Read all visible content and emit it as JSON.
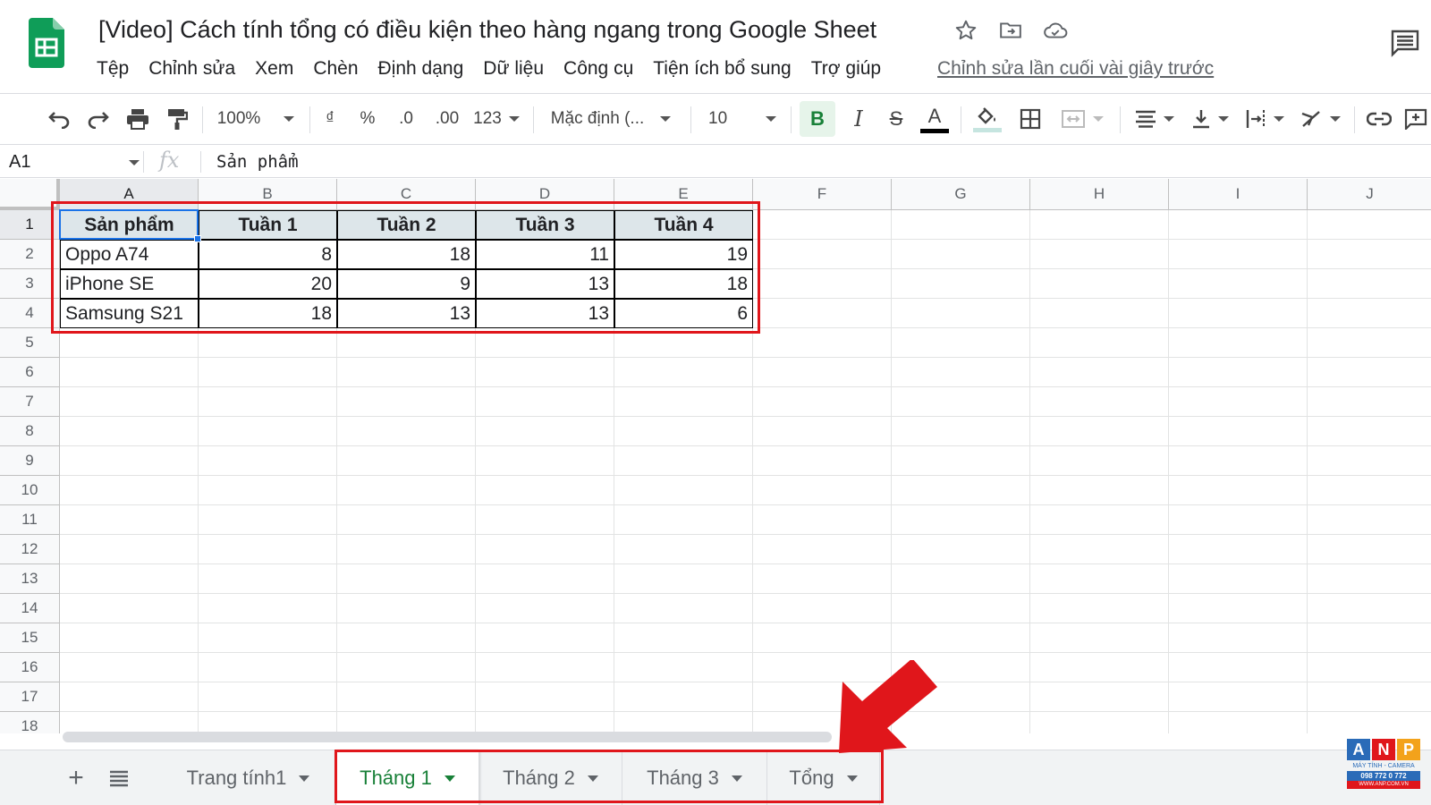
{
  "header": {
    "title": "[Video] Cách tính tổng có điều kiện theo hàng ngang trong Google Sheet",
    "menu": [
      "Tệp",
      "Chỉnh sửa",
      "Xem",
      "Chèn",
      "Định dạng",
      "Dữ liệu",
      "Công cụ",
      "Tiện ích bổ sung",
      "Trợ giúp"
    ],
    "last_edit": "Chỉnh sửa lần cuối vài giây trước"
  },
  "toolbar": {
    "zoom": "100%",
    "currency": "₫",
    "percent": "%",
    "dec_decrease": ".0",
    "dec_increase": ".00",
    "format_more": "123",
    "font": "Mặc định (...",
    "font_size": "10",
    "bold": "B",
    "italic": "I",
    "strike": "S",
    "text_color": "A"
  },
  "formula_bar": {
    "cell_ref": "A1",
    "fx": "fx",
    "content": "Sản phẩm"
  },
  "columns": [
    "A",
    "B",
    "C",
    "D",
    "E",
    "F",
    "G",
    "H",
    "I",
    "J"
  ],
  "rows": [
    "1",
    "2",
    "3",
    "4",
    "5",
    "6",
    "7",
    "8",
    "9",
    "10",
    "11",
    "12",
    "13",
    "14",
    "15",
    "16",
    "17",
    "18"
  ],
  "table": {
    "headers": [
      "Sản phẩm",
      "Tuần 1",
      "Tuần 2",
      "Tuần 3",
      "Tuần 4"
    ],
    "data": [
      [
        "Oppo A74",
        "8",
        "18",
        "11",
        "19"
      ],
      [
        "iPhone SE",
        "20",
        "9",
        "13",
        "18"
      ],
      [
        "Samsung S21",
        "18",
        "13",
        "13",
        "6"
      ]
    ]
  },
  "sheets": {
    "add": "+",
    "tabs": [
      "Trang tính1",
      "Tháng 1",
      "Tháng 2",
      "Tháng 3",
      "Tổng"
    ],
    "active": "Tháng 1"
  },
  "watermark": {
    "letters": [
      "A",
      "N",
      "P"
    ],
    "tagline": "MÁY TÍNH - CAMERA",
    "phone": "098 772 0 772",
    "web": "WWW.ANP.COM.VN"
  },
  "colors": {
    "accent_green": "#188038",
    "highlight_red": "#e0161b",
    "header_fill": "#dde6ea",
    "selection_blue": "#1a73e8"
  }
}
